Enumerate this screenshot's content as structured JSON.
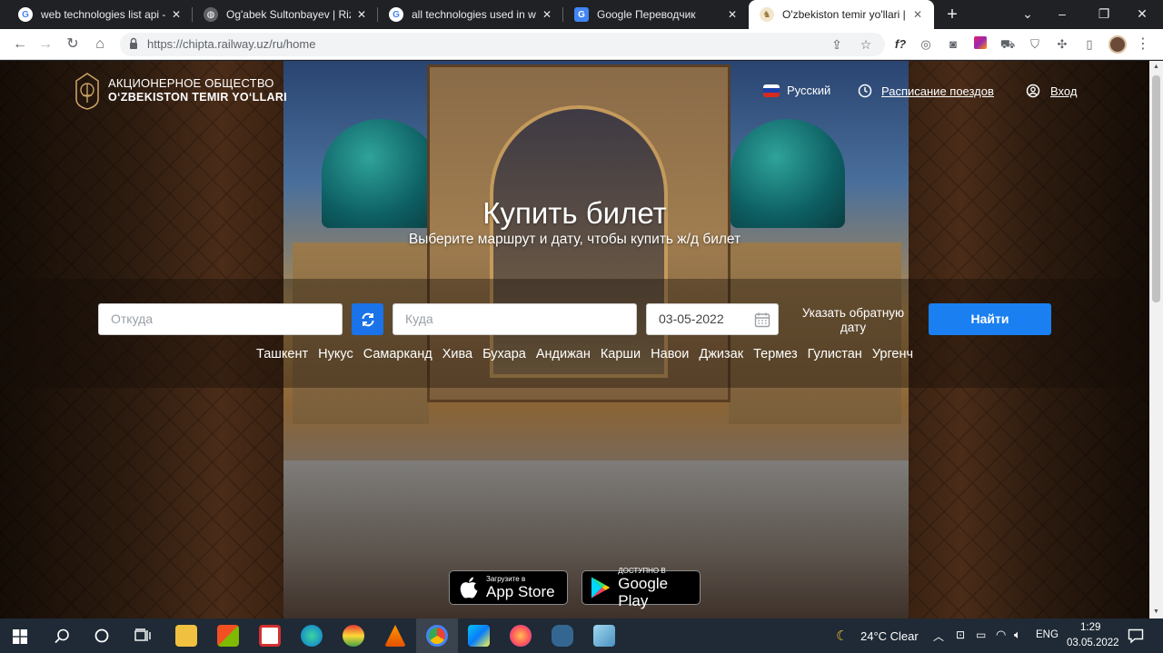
{
  "browser": {
    "tabs": [
      {
        "title": "web technologies list api - Go",
        "favicon": "google-icon",
        "active": false
      },
      {
        "title": "Og'abek Sultonbayev | Rizqim",
        "favicon": "globe-icon",
        "active": false
      },
      {
        "title": "all technologies used in web",
        "favicon": "google-icon",
        "active": false
      },
      {
        "title": "Google Переводчик",
        "favicon": "google-translate-icon",
        "active": false
      },
      {
        "title": "O'zbekiston temir yo'llari | Гл",
        "favicon": "uty-logo-icon",
        "active": true
      }
    ],
    "new_tab": "+",
    "url": "https://chipta.railway.uz/ru/home"
  },
  "site": {
    "brand_line1": "АКЦИОНЕРНОЕ ОБЩЕСТВО",
    "brand_line2": "O‘ZBEKISTON TEMIR YO‘LLARI",
    "language": "Русский",
    "schedule": "Расписание поездов",
    "login": "Вход"
  },
  "hero": {
    "title": "Купить билет",
    "subtitle": "Выберите маршрут и дату, чтобы купить ж/д билет"
  },
  "search": {
    "from_placeholder": "Откуда",
    "to_placeholder": "Куда",
    "date": "03-05-2022",
    "return_date_line1": "Указать обратную",
    "return_date_line2": "дату",
    "find_button": "Найти"
  },
  "cities": [
    "Ташкент",
    "Нукус",
    "Самарканд",
    "Хива",
    "Бухара",
    "Андижан",
    "Карши",
    "Навои",
    "Джизак",
    "Термез",
    "Гулистан",
    "Ургенч"
  ],
  "stores": {
    "appstore_small": "Загрузите в",
    "appstore_big": "App Store",
    "googleplay_small": "ДОСТУПНО В",
    "googleplay_big": "Google Play"
  },
  "taskbar": {
    "weather": "24°C  Clear",
    "lang": "ENG",
    "time": "1:29",
    "date": "03.05.2022"
  },
  "colors": {
    "primary": "#1a7ff0",
    "tabstrip": "#202124",
    "taskbar": "#1f2a36"
  }
}
